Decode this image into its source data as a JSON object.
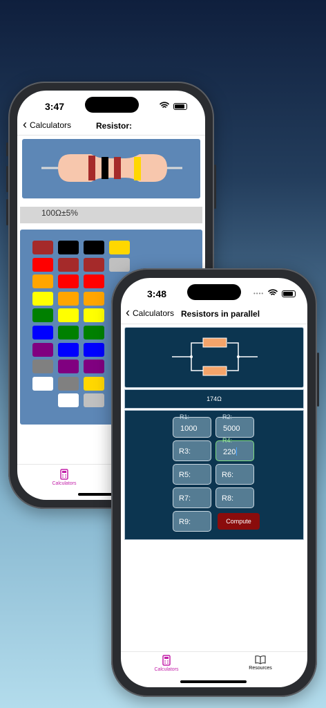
{
  "phone1": {
    "time": "3:47",
    "back_label": "Calculators",
    "title": "Resistor:",
    "result": "100Ω±5%",
    "tab_calculators": "Calculators",
    "swatches": [
      [
        "#a52a2a",
        "#000000",
        "#000000",
        "#ffd700"
      ],
      [
        "#ff0000",
        "#a52a2a",
        "#a52a2a",
        "#c0c0c0"
      ],
      [
        "#ffa500",
        "#ff0000",
        "#ff0000",
        ""
      ],
      [
        "#ffff00",
        "#ffa500",
        "#ffa500",
        ""
      ],
      [
        "#008000",
        "#ffff00",
        "#ffff00",
        ""
      ],
      [
        "#0000ff",
        "#008000",
        "#008000",
        ""
      ],
      [
        "#800080",
        "#0000ff",
        "#0000ff",
        ""
      ],
      [
        "#808080",
        "#800080",
        "#800080",
        ""
      ],
      [
        "#ffffff",
        "#808080",
        "#ffd700",
        ""
      ],
      [
        "",
        "#ffffff",
        "#c0c0c0",
        ""
      ]
    ]
  },
  "phone2": {
    "time": "3:48",
    "back_label": "Calculators",
    "title": "Resistors in parallel",
    "result": "174Ω",
    "fields": {
      "r1": {
        "label": "R1:",
        "value": "1000"
      },
      "r2": {
        "label": "R2:",
        "value": "5000"
      },
      "r3": {
        "label": "R3:"
      },
      "r4": {
        "label": "R4:",
        "value": "220"
      },
      "r5": {
        "label": "R5:"
      },
      "r6": {
        "label": "R6:"
      },
      "r7": {
        "label": "R7:"
      },
      "r8": {
        "label": "R8:"
      },
      "r9": {
        "label": "R9:"
      }
    },
    "compute_label": "Compute",
    "tab_calculators": "Calculators",
    "tab_resources": "Resources"
  },
  "colors": {
    "accent": "#c21ea8",
    "dark_panel": "#0c3550",
    "compute": "#8a0c0c",
    "resistor_panel": "#5d87b6"
  }
}
